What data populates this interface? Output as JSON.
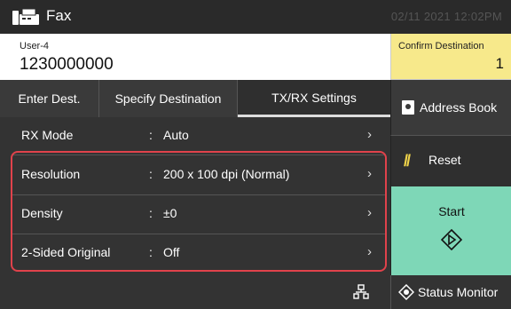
{
  "header": {
    "title": "Fax",
    "datetime": "02/11 2021 12:02PM"
  },
  "destination": {
    "user_label": "User-4",
    "number": "1230000000",
    "confirm_label": "Confirm Destination",
    "confirm_count": "1"
  },
  "tabs": [
    {
      "label": "Enter Dest."
    },
    {
      "label": "Specify Destination"
    },
    {
      "label": "TX/RX Settings"
    }
  ],
  "settings": [
    {
      "label": "RX Mode",
      "value": "Auto"
    },
    {
      "label": "Resolution",
      "value": "200 x 100 dpi (Normal)"
    },
    {
      "label": "Density",
      "value": "±0"
    },
    {
      "label": "2-Sided Original",
      "value": "Off"
    }
  ],
  "side": {
    "address_book": "Address Book",
    "reset": "Reset",
    "start": "Start"
  },
  "footer": {
    "status_monitor": "Status Monitor"
  },
  "colors": {
    "start": "#7ed7b7",
    "confirm": "#f7e98b",
    "highlight": "#e0424b"
  }
}
